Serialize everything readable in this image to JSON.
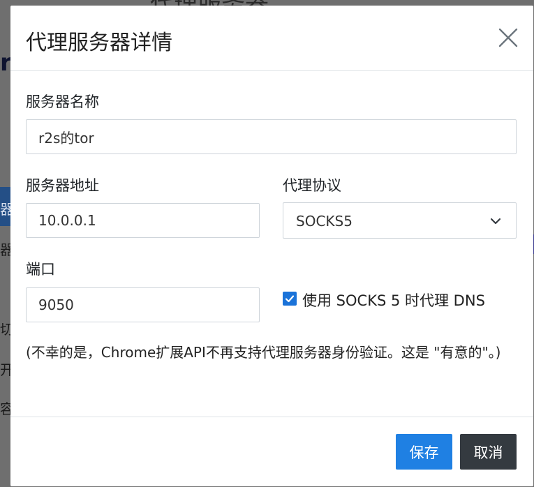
{
  "background": {
    "title_fragment": "代理服务器",
    "fragment_r": "r",
    "fragment_blue": "器",
    "fragment_1": "器",
    "fragment_2": "切",
    "fragment_3": "开",
    "fragment_4": "容"
  },
  "modal": {
    "title": "代理服务器详情",
    "close_icon": "close-icon"
  },
  "form": {
    "server_name": {
      "label": "服务器名称",
      "value": "r2s的tor"
    },
    "server_address": {
      "label": "服务器地址",
      "value": "10.0.0.1"
    },
    "protocol": {
      "label": "代理协议",
      "selected": "SOCKS5"
    },
    "port": {
      "label": "端口",
      "value": "9050"
    },
    "socks_dns": {
      "label": "使用 SOCKS 5 时代理 DNS",
      "checked": true
    }
  },
  "note": "(不幸的是，Chrome扩展API不再支持代理服务器身份验证。这是 \"有意的\"。)",
  "footer": {
    "save_label": "保存",
    "cancel_label": "取消"
  },
  "colors": {
    "primary": "#1f80e3",
    "dark": "#343a40",
    "checkbox": "#1a73d9"
  }
}
